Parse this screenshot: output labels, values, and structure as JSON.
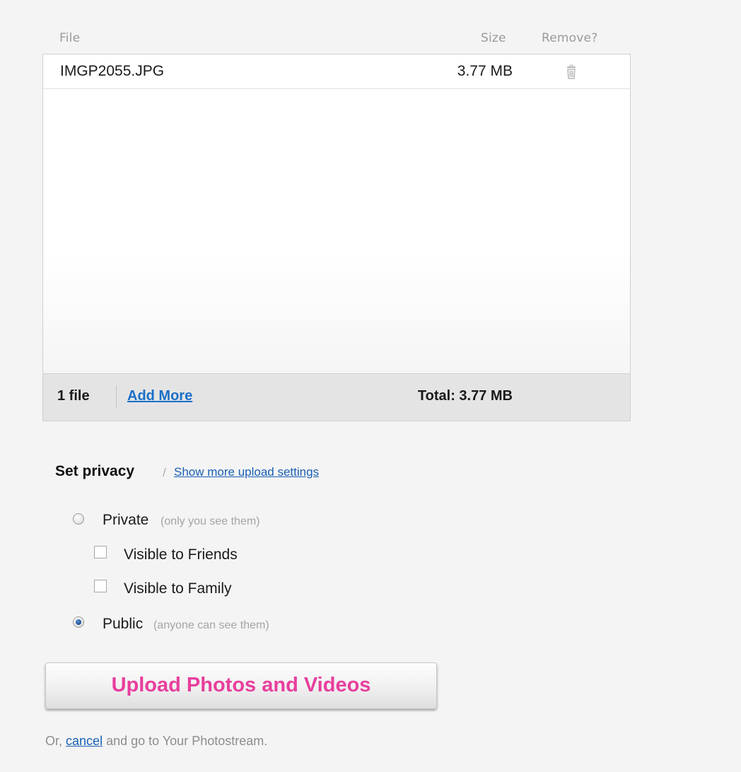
{
  "table": {
    "headers": {
      "file": "File",
      "size": "Size",
      "remove": "Remove?"
    },
    "rows": [
      {
        "name": "IMGP2055.JPG",
        "size": "3.77 MB",
        "remove_icon": "trash-icon"
      }
    ],
    "footer": {
      "count": "1 file",
      "add_more": "Add More",
      "total": "Total: 3.77 MB"
    }
  },
  "privacy": {
    "heading": "Set privacy",
    "separator": "/",
    "more_settings_link": "Show more upload settings",
    "options": {
      "private": {
        "label": "Private",
        "hint": "(only you see them)",
        "selected": false
      },
      "friends": {
        "label": "Visible to Friends",
        "checked": false
      },
      "family": {
        "label": "Visible to Family",
        "checked": false
      },
      "public": {
        "label": "Public",
        "hint": "(anyone can see them)",
        "selected": true
      }
    }
  },
  "upload_button": {
    "label": "Upload Photos and Videos",
    "color": "#e83e9d"
  },
  "cancel": {
    "prefix": "Or,",
    "link": "cancel",
    "suffix": "and go to Your Photostream."
  }
}
